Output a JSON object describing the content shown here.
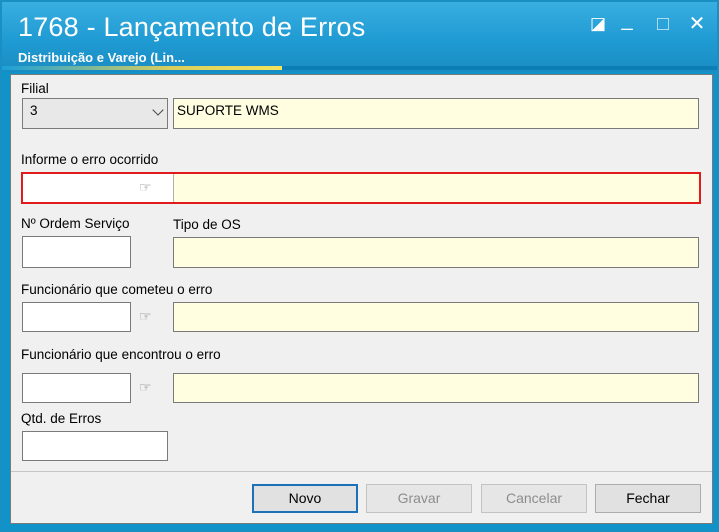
{
  "window": {
    "title": "1768 - Lançamento de Erros",
    "subtitle": "Distribuição e Varejo (Lin...",
    "controls": {
      "restore": "◪",
      "minimize": "_",
      "maximize": "□",
      "close": "✕"
    }
  },
  "form": {
    "filial": {
      "label": "Filial",
      "code": "3",
      "name": "SUPORTE WMS"
    },
    "erro": {
      "label": "Informe o erro ocorrido",
      "code": "",
      "description": ""
    },
    "ordem_servico": {
      "label": "Nº Ordem Serviço",
      "value": ""
    },
    "tipo_os": {
      "label": "Tipo de OS",
      "value": ""
    },
    "func_cometeu": {
      "label": "Funcionário que cometeu o erro",
      "code": "",
      "name": ""
    },
    "func_encontrou": {
      "label": "Funcionário que encontrou o erro",
      "code": "",
      "name": ""
    },
    "qtd_erros": {
      "label": "Qtd. de  Erros",
      "value": ""
    },
    "lookup_icon": "☞"
  },
  "buttons": {
    "novo": "Novo",
    "gravar": "Gravar",
    "cancelar": "Cancelar",
    "fechar": "Fechar"
  },
  "colors": {
    "title_bar": "#1f9bd3",
    "readonly_field": "#fffee1",
    "error_border": "#e11b1b",
    "primary_border": "#1d71b8"
  }
}
